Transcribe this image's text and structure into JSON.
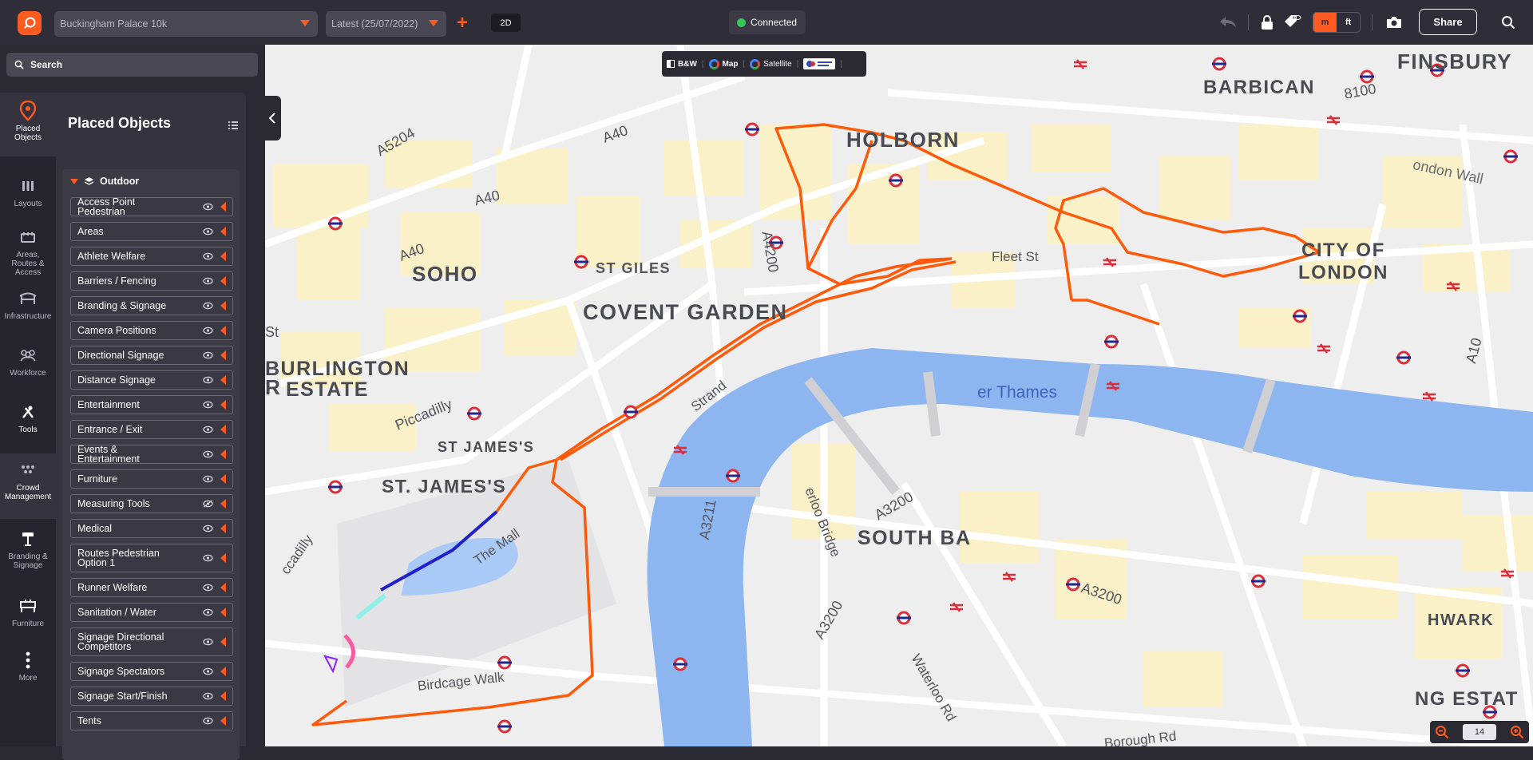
{
  "header": {
    "event_select": "Buckingham Palace 10k",
    "version_select": "Latest (25/07/2022)",
    "view_mode": "2D",
    "connection_status": "Connected",
    "unit_m": "m",
    "unit_ft": "ft",
    "share_label": "Share",
    "accent_color": "#ff5a1f"
  },
  "sidebar": {
    "search_label": "Search",
    "rail": [
      {
        "label": "Placed Objects",
        "icon": "location-pin-icon"
      },
      {
        "label": "Layouts",
        "icon": "layouts-icon"
      },
      {
        "label": "Areas, Routes & Access",
        "icon": "areas-icon"
      },
      {
        "label": "Infrastructure",
        "icon": "infrastructure-icon"
      },
      {
        "label": "Workforce",
        "icon": "workforce-icon"
      },
      {
        "label": "Tools",
        "icon": "tools-icon"
      },
      {
        "label": "Crowd Management",
        "icon": "crowd-icon"
      },
      {
        "label": "Branding & Signage",
        "icon": "signage-icon"
      },
      {
        "label": "Furniture",
        "icon": "furniture-icon"
      },
      {
        "label": "More",
        "icon": "more-icon"
      }
    ],
    "panel_title": "Placed Objects",
    "group_label": "Outdoor",
    "items": [
      {
        "label": "Access Point Pedestrian",
        "visible": true
      },
      {
        "label": "Areas",
        "visible": true
      },
      {
        "label": "Athlete Welfare",
        "visible": true
      },
      {
        "label": "Barriers / Fencing",
        "visible": true
      },
      {
        "label": "Branding & Signage",
        "visible": true
      },
      {
        "label": "Camera Positions",
        "visible": true
      },
      {
        "label": "Directional Signage",
        "visible": true
      },
      {
        "label": "Distance Signage",
        "visible": true
      },
      {
        "label": "Entertainment",
        "visible": true
      },
      {
        "label": "Entrance / Exit",
        "visible": true
      },
      {
        "label": "Events & Entertainment",
        "visible": true
      },
      {
        "label": "Furniture",
        "visible": true
      },
      {
        "label": "Measuring Tools",
        "visible": false
      },
      {
        "label": "Medical",
        "visible": true
      },
      {
        "label": "Routes Pedestrian Option 1",
        "visible": true
      },
      {
        "label": "Runner Welfare",
        "visible": true
      },
      {
        "label": "Sanitation / Water",
        "visible": true
      },
      {
        "label": "Signage Directional Competitors",
        "visible": true
      },
      {
        "label": "Signage Spectators",
        "visible": true
      },
      {
        "label": "Signage Start/Finish",
        "visible": true
      },
      {
        "label": "Tents",
        "visible": true
      }
    ]
  },
  "map": {
    "layers": {
      "bw": "B&W",
      "map": "Map",
      "satellite": "Satellite"
    },
    "zoom_level": "14",
    "labels": {
      "finsbury": "FINSBURY",
      "barbican": "BARBICAN",
      "holborn": "HOLBORN",
      "london_wall": "ondon Wall",
      "city1": "CITY OF",
      "city2": "LONDON",
      "fleet": "Fleet St",
      "soho": "SOHO",
      "st_giles": "ST GILES",
      "covent": "COVENT GARDEN",
      "burlington1": "BURLINGTON",
      "burlington2": "ESTATE",
      "thames": "er Thames",
      "piccadilly": "Piccadilly",
      "stjames_s": "ST JAMES'S",
      "stjames_b": "ST. JAMES'S",
      "south_bank": "SOUTH BA",
      "mall": "The Mall",
      "birdcage": "Birdcage Walk",
      "waterloo_bridge": "erloo Bridge",
      "waterloo_rd": "Waterloo Rd",
      "borough": "Borough Rd",
      "hwark": "HWARK",
      "ng_estat": "NG ESTAT",
      "strand": "Strand",
      "a40a": "A40",
      "a40b": "A40",
      "a40c": "A40",
      "a5204": "A5204",
      "a4200": "A4200",
      "a3211": "A3211",
      "a3200a": "A3200",
      "a3200b": "A3200",
      "a3200c": "A3200",
      "a10": "A10",
      "st_left": "St",
      "r_left": "R",
      "piccadilly2": "ccadilly",
      "e8100": "8100"
    }
  }
}
